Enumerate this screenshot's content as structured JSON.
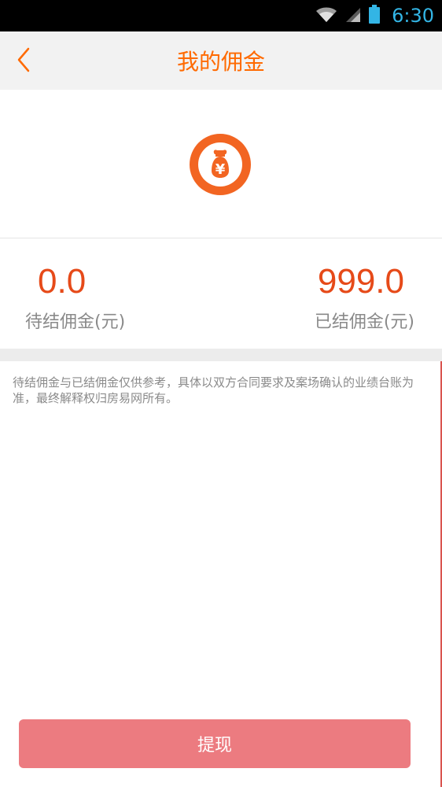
{
  "status_bar": {
    "time": "6:30",
    "icons": [
      "wifi-icon",
      "signal-icon",
      "battery-icon"
    ],
    "time_color": "#33b5e5"
  },
  "nav": {
    "back_icon": "chevron-left-icon",
    "title": "我的佣金",
    "accent_color": "#ff6a00"
  },
  "commission": {
    "pending_amount": "0.0",
    "pending_label": "待结佣金(元)",
    "settled_amount": "999.0",
    "settled_label": "已结佣金(元)",
    "amount_color": "#e64a19"
  },
  "disclaimer": "待结佣金与已结佣金仅供参考，具体以双方合同要求及案场确认的业绩台账为准，最终解释权归房易网所有。",
  "actions": {
    "withdraw_label": "提现",
    "withdraw_color": "#ec7b80"
  }
}
